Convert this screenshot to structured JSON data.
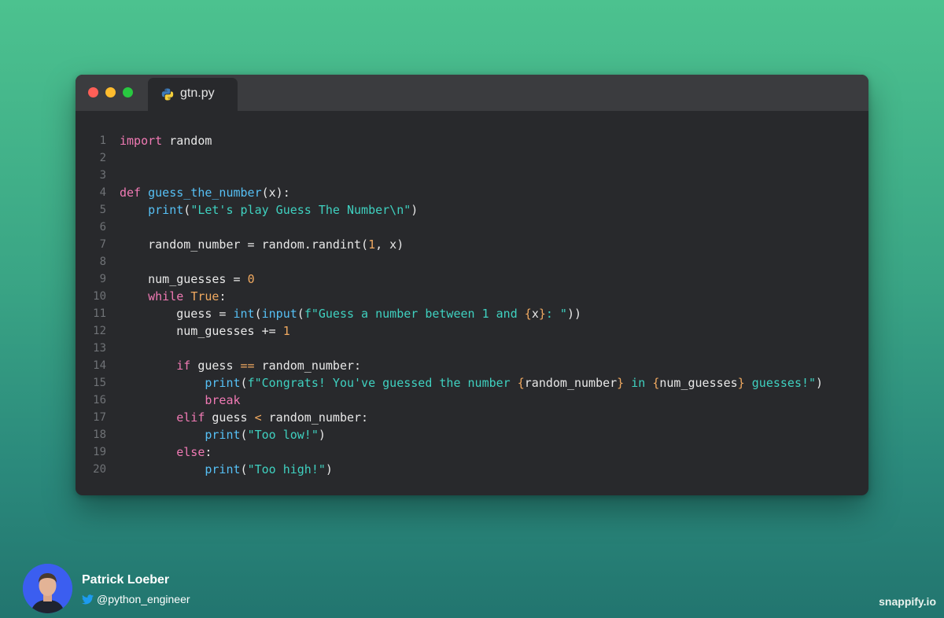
{
  "editor": {
    "tab_label": "gtn.py",
    "tab_icon": "python-icon",
    "window_controls": [
      "close",
      "minimize",
      "maximize"
    ]
  },
  "code_lines": [
    {
      "n": "1",
      "tokens": [
        [
          "kw",
          "import"
        ],
        [
          "t",
          " random"
        ]
      ]
    },
    {
      "n": "2",
      "tokens": []
    },
    {
      "n": "3",
      "tokens": []
    },
    {
      "n": "4",
      "tokens": [
        [
          "kw",
          "def"
        ],
        [
          "t",
          " "
        ],
        [
          "fn",
          "guess_the_number"
        ],
        [
          "t",
          "(x):"
        ]
      ]
    },
    {
      "n": "5",
      "tokens": [
        [
          "t",
          "    "
        ],
        [
          "fn",
          "print"
        ],
        [
          "t",
          "("
        ],
        [
          "st",
          "\"Let's play Guess The Number\\n\""
        ],
        [
          "t",
          ")"
        ]
      ]
    },
    {
      "n": "6",
      "tokens": []
    },
    {
      "n": "7",
      "tokens": [
        [
          "t",
          "    random_number = random.randint("
        ],
        [
          "nm",
          "1"
        ],
        [
          "t",
          ", x)"
        ]
      ]
    },
    {
      "n": "8",
      "tokens": []
    },
    {
      "n": "9",
      "tokens": [
        [
          "t",
          "    num_guesses = "
        ],
        [
          "nm",
          "0"
        ]
      ]
    },
    {
      "n": "10",
      "tokens": [
        [
          "t",
          "    "
        ],
        [
          "kw",
          "while"
        ],
        [
          "t",
          " "
        ],
        [
          "nm",
          "True"
        ],
        [
          "t",
          ":"
        ]
      ]
    },
    {
      "n": "11",
      "tokens": [
        [
          "t",
          "        guess = "
        ],
        [
          "fn",
          "int"
        ],
        [
          "t",
          "("
        ],
        [
          "fn",
          "input"
        ],
        [
          "t",
          "("
        ],
        [
          "st",
          "f\"Guess a number between 1 and "
        ],
        [
          "op",
          "{"
        ],
        [
          "t",
          "x"
        ],
        [
          "op",
          "}"
        ],
        [
          "st",
          ": \""
        ],
        [
          "t",
          "))"
        ]
      ]
    },
    {
      "n": "12",
      "tokens": [
        [
          "t",
          "        num_guesses += "
        ],
        [
          "nm",
          "1"
        ]
      ]
    },
    {
      "n": "13",
      "tokens": []
    },
    {
      "n": "14",
      "tokens": [
        [
          "t",
          "        "
        ],
        [
          "kw",
          "if"
        ],
        [
          "t",
          " guess "
        ],
        [
          "op",
          "=="
        ],
        [
          "t",
          " random_number:"
        ]
      ]
    },
    {
      "n": "15",
      "tokens": [
        [
          "t",
          "            "
        ],
        [
          "fn",
          "print"
        ],
        [
          "t",
          "("
        ],
        [
          "st",
          "f\"Congrats! You've guessed the number "
        ],
        [
          "op",
          "{"
        ],
        [
          "t",
          "random_number"
        ],
        [
          "op",
          "}"
        ],
        [
          "st",
          " in "
        ],
        [
          "op",
          "{"
        ],
        [
          "t",
          "num_guesses"
        ],
        [
          "op",
          "}"
        ],
        [
          "st",
          " guesses!\""
        ],
        [
          "t",
          ")"
        ]
      ]
    },
    {
      "n": "16",
      "tokens": [
        [
          "t",
          "            "
        ],
        [
          "kw",
          "break"
        ]
      ]
    },
    {
      "n": "17",
      "tokens": [
        [
          "t",
          "        "
        ],
        [
          "kw",
          "elif"
        ],
        [
          "t",
          " guess "
        ],
        [
          "op",
          "<"
        ],
        [
          "t",
          " random_number:"
        ]
      ]
    },
    {
      "n": "18",
      "tokens": [
        [
          "t",
          "            "
        ],
        [
          "fn",
          "print"
        ],
        [
          "t",
          "("
        ],
        [
          "st",
          "\"Too low!\""
        ],
        [
          "t",
          ")"
        ]
      ]
    },
    {
      "n": "19",
      "tokens": [
        [
          "t",
          "        "
        ],
        [
          "kw",
          "else"
        ],
        [
          "t",
          ":"
        ]
      ]
    },
    {
      "n": "20",
      "tokens": [
        [
          "t",
          "            "
        ],
        [
          "fn",
          "print"
        ],
        [
          "t",
          "("
        ],
        [
          "st",
          "\"Too high!\""
        ],
        [
          "t",
          ")"
        ]
      ]
    }
  ],
  "footer": {
    "author_name": "Patrick Loeber",
    "author_handle": "@python_engineer",
    "handle_icon": "twitter-icon",
    "brand": "snappify.io"
  },
  "colors": {
    "keyword": "#f07ab4",
    "function": "#56c0f5",
    "string": "#3fd1c0",
    "number": "#f0a960",
    "text": "#e8e8e8",
    "line_number": "#6f7276",
    "editor_bg": "#28292c"
  }
}
